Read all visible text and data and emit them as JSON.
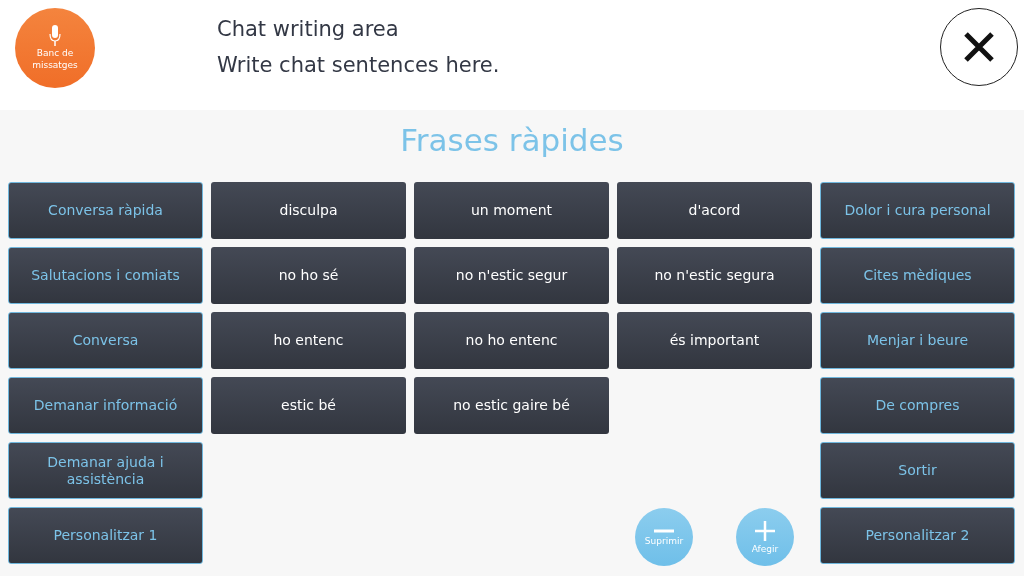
{
  "header": {
    "bank_button": "Banc de\nmissatges",
    "title": "Chat writing area",
    "subtitle": "Write chat sentences here."
  },
  "heading": "Frases ràpides",
  "left_categories": [
    "Conversa ràpida",
    "Salutacions i comiats",
    "Conversa",
    "Demanar informació",
    "Demanar ajuda i assistència",
    "Personalitzar 1"
  ],
  "phrases": [
    [
      "disculpa",
      "un moment",
      "d'acord"
    ],
    [
      "no ho sé",
      "no n'estic segur",
      "no n'estic segura"
    ],
    [
      "ho entenc",
      "no ho entenc",
      "és important"
    ],
    [
      "estic bé",
      "no estic gaire bé"
    ]
  ],
  "right_categories": [
    "Dolor i cura personal",
    "Cites mèdiques",
    "Menjar i beure",
    "De compres",
    "Sortir",
    "Personalitzar 2"
  ],
  "actions": [
    {
      "kind": "remove",
      "label": "Suprimir"
    },
    {
      "kind": "add",
      "label": "Afegir"
    }
  ]
}
